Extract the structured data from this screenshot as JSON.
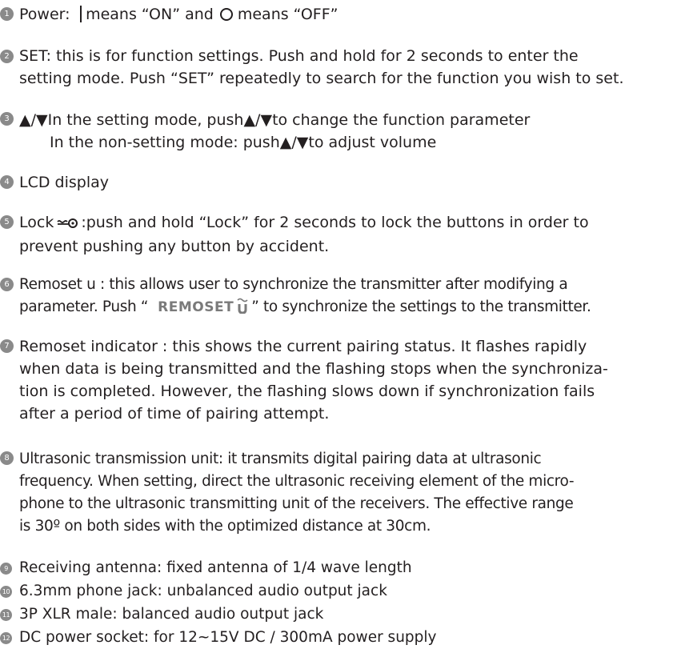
{
  "items": [
    {
      "number": "1",
      "power_prefix": "Power: ",
      "on_text": "means “ON” and",
      "off_text": "means “OFF”",
      "on_symbol": "bar-symbol",
      "off_symbol": "circle-symbol"
    },
    {
      "number": "2",
      "lines": [
        "SET: this is for function settings. Push and hold for 2 seconds to enter the",
        "setting mode. Push “SET” repeatedly to search for the function you wish to set."
      ]
    },
    {
      "number": "3",
      "lines": [
        "▲/▼In the setting mode, push▲/▼to change the function parameter",
        "In the non-setting mode: push▲/▼to adjust volume"
      ]
    },
    {
      "number": "4",
      "lines": [
        "LCD display"
      ]
    },
    {
      "number": "5",
      "lock_prefix": "Lock",
      "lock_rest": ":push and hold “Lock” for 2 seconds to lock the buttons in order to",
      "line2": "prevent pushing any button by accident.",
      "lock_icon": "key-icon"
    },
    {
      "number": "6",
      "line1": "Remoset u : this allows user to synchronize the transmitter after modifying a",
      "line2_prefix": "parameter. Push “",
      "brand": "REMOSET",
      "line2_suffix": "” to synchronize the settings to the transmitter.",
      "wave_icon": "ultrasonic-wave-icon"
    },
    {
      "number": "7",
      "lines": [
        "Remoset indicator : this shows the current pairing status. It flashes rapidly",
        "when data is being transmitted and the flashing stops when the synchroniza-",
        "tion is completed. However, the flashing slows down if synchronization fails",
        "after a period of time of pairing attempt."
      ]
    },
    {
      "number": "8",
      "lines": [
        "Ultrasonic transmission unit: it transmits digital pairing data at ultrasonic",
        "frequency. When setting, direct the ultrasonic receiving element of the micro-",
        "phone to the ultrasonic transmitting unit of the receivers. The effective range",
        "is 30º on both sides with the optimized distance at 30cm."
      ]
    },
    {
      "number": "9",
      "lines": [
        "Receiving antenna: fixed antenna of 1/4 wave length"
      ]
    },
    {
      "number": "10",
      "lines": [
        "6.3mm phone jack: unbalanced audio output jack"
      ]
    },
    {
      "number": "11",
      "lines": [
        "3P XLR male: balanced audio output jack"
      ]
    },
    {
      "number": "12",
      "lines": [
        "DC power socket: for 12~15V DC / 300mA power supply"
      ]
    }
  ],
  "colors": {
    "text": "#231f20",
    "badge": "#8a8a8a",
    "brand": "#7a7a7a"
  }
}
